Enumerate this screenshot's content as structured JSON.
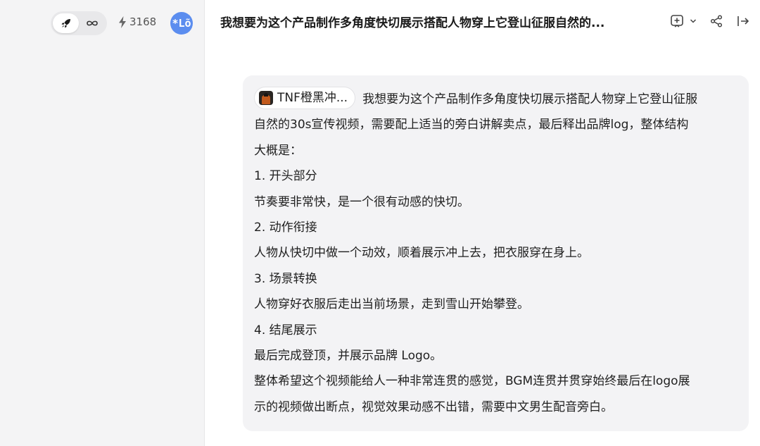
{
  "sidebar": {
    "mode_toggle": {
      "options": [
        {
          "icon": "rocket-icon",
          "active": true
        },
        {
          "icon": "infinity-icon",
          "label": "∞",
          "active": false
        }
      ]
    },
    "credits": {
      "icon": "lightning-icon",
      "value": "3168"
    },
    "avatar": {
      "text": "*Lõ"
    }
  },
  "header": {
    "title": "我想要为这个产品制作多角度快切展示搭配人物穿上它登山征服自然的...",
    "actions": [
      "add-note-icon",
      "chevron-down-icon",
      "share-icon",
      "collapse-panel-icon"
    ]
  },
  "message": {
    "chip_label": "TNF橙黑冲...",
    "lines": [
      "我想要为这个产品制作多角度快切展示搭配人物穿上它登山征服",
      "自然的30s宣传视频，需要配上适当的旁白讲解卖点，最后释出品牌log，整体结构",
      "大概是：",
      "1. 开头部分",
      "节奏要非常快，是一个很有动感的快切。",
      "2. 动作衔接",
      "人物从快切中做一个动效，顺着展示冲上去，把衣服穿在身上。",
      "3. 场景转换",
      "人物穿好衣服后走出当前场景，走到雪山开始攀登。",
      "4. 结尾展示",
      "最后完成登顶，并展示品牌 Logo。",
      "整体希望这个视频能给人一种非常连贯的感觉，BGM连贯并贯穿始终最后在logo展",
      "示的视频做出断点，视觉效果动感不出错，需要中文男生配音旁白。"
    ]
  },
  "colors": {
    "sidebar_bg": "#f4f4f5",
    "bubble_bg": "#f3f3f5",
    "avatar_bg": "#5b8def"
  }
}
